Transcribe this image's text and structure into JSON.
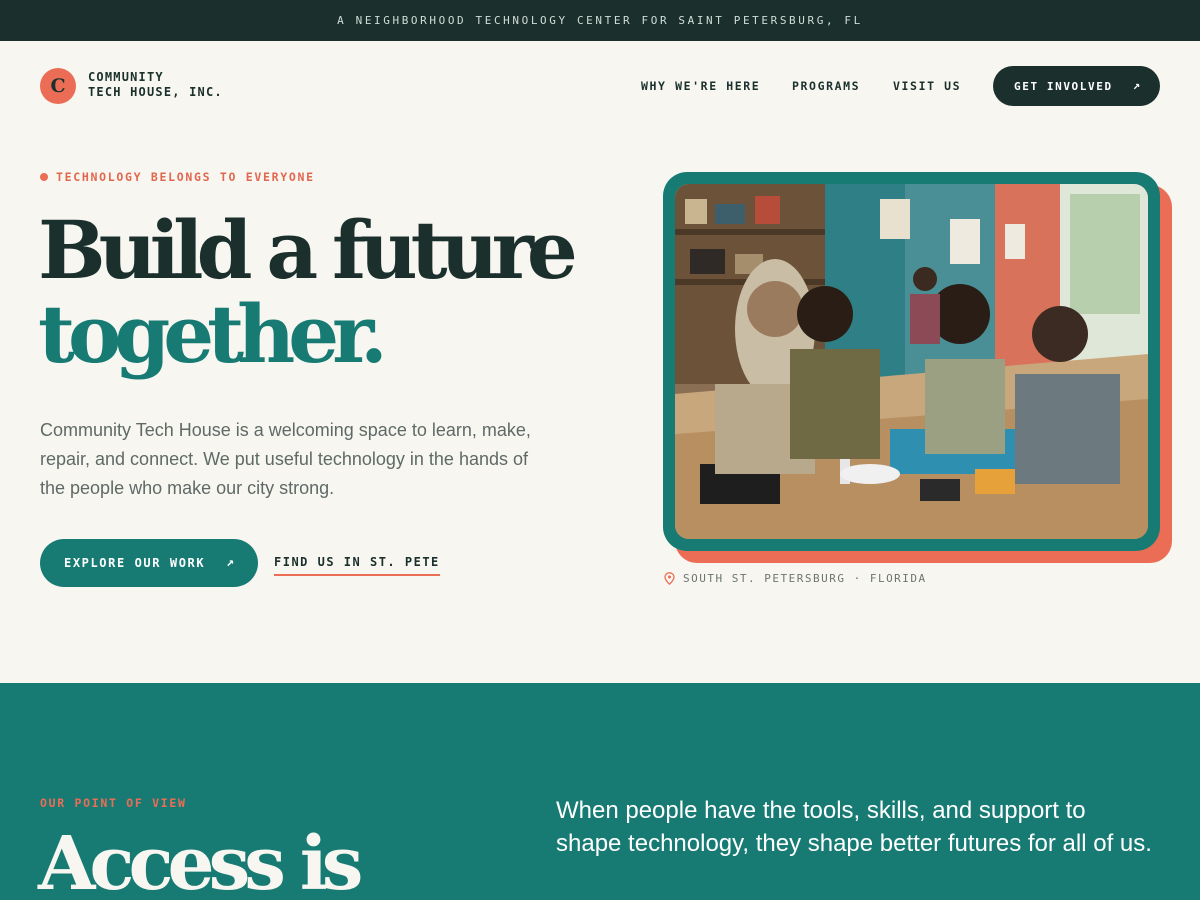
{
  "announcement": {
    "text": "A NEIGHBORHOOD TECHNOLOGY CENTER FOR SAINT PETERSBURG, FL"
  },
  "header": {
    "logo_letter": "C",
    "brand_line1": "COMMUNITY",
    "brand_line2": "TECH HOUSE, INC.",
    "nav": [
      {
        "label": "WHY WE'RE HERE"
      },
      {
        "label": "PROGRAMS"
      },
      {
        "label": "VISIT US"
      }
    ],
    "cta_label": "GET INVOLVED",
    "cta_icon": "arrow-up-right-icon"
  },
  "hero": {
    "eyebrow": "TECHNOLOGY BELONGS TO EVERYONE",
    "headline_line1": "Build a future",
    "headline_line2": "together.",
    "lede": "Community Tech House is a welcoming space to learn, make, repair, and connect. We put useful technology in the hands of the people who make our city strong.",
    "primary_button": "EXPLORE OUR WORK",
    "secondary_link": "FIND US IN ST. PETE",
    "photo_description": "people working on electronics at a community workshop table",
    "photo_caption": "SOUTH ST. PETERSBURG · FLORIDA",
    "caption_icon": "map-pin-icon"
  },
  "point_of_view": {
    "label": "OUR POINT OF VIEW",
    "heading": "Access is",
    "statement": "When people have the tools, skills, and support to shape technology, they shape better futures for all of us."
  },
  "colors": {
    "dark_green": "#1b302d",
    "teal": "#177b74",
    "coral": "#ec6d56",
    "cream": "#f7f6f1"
  }
}
